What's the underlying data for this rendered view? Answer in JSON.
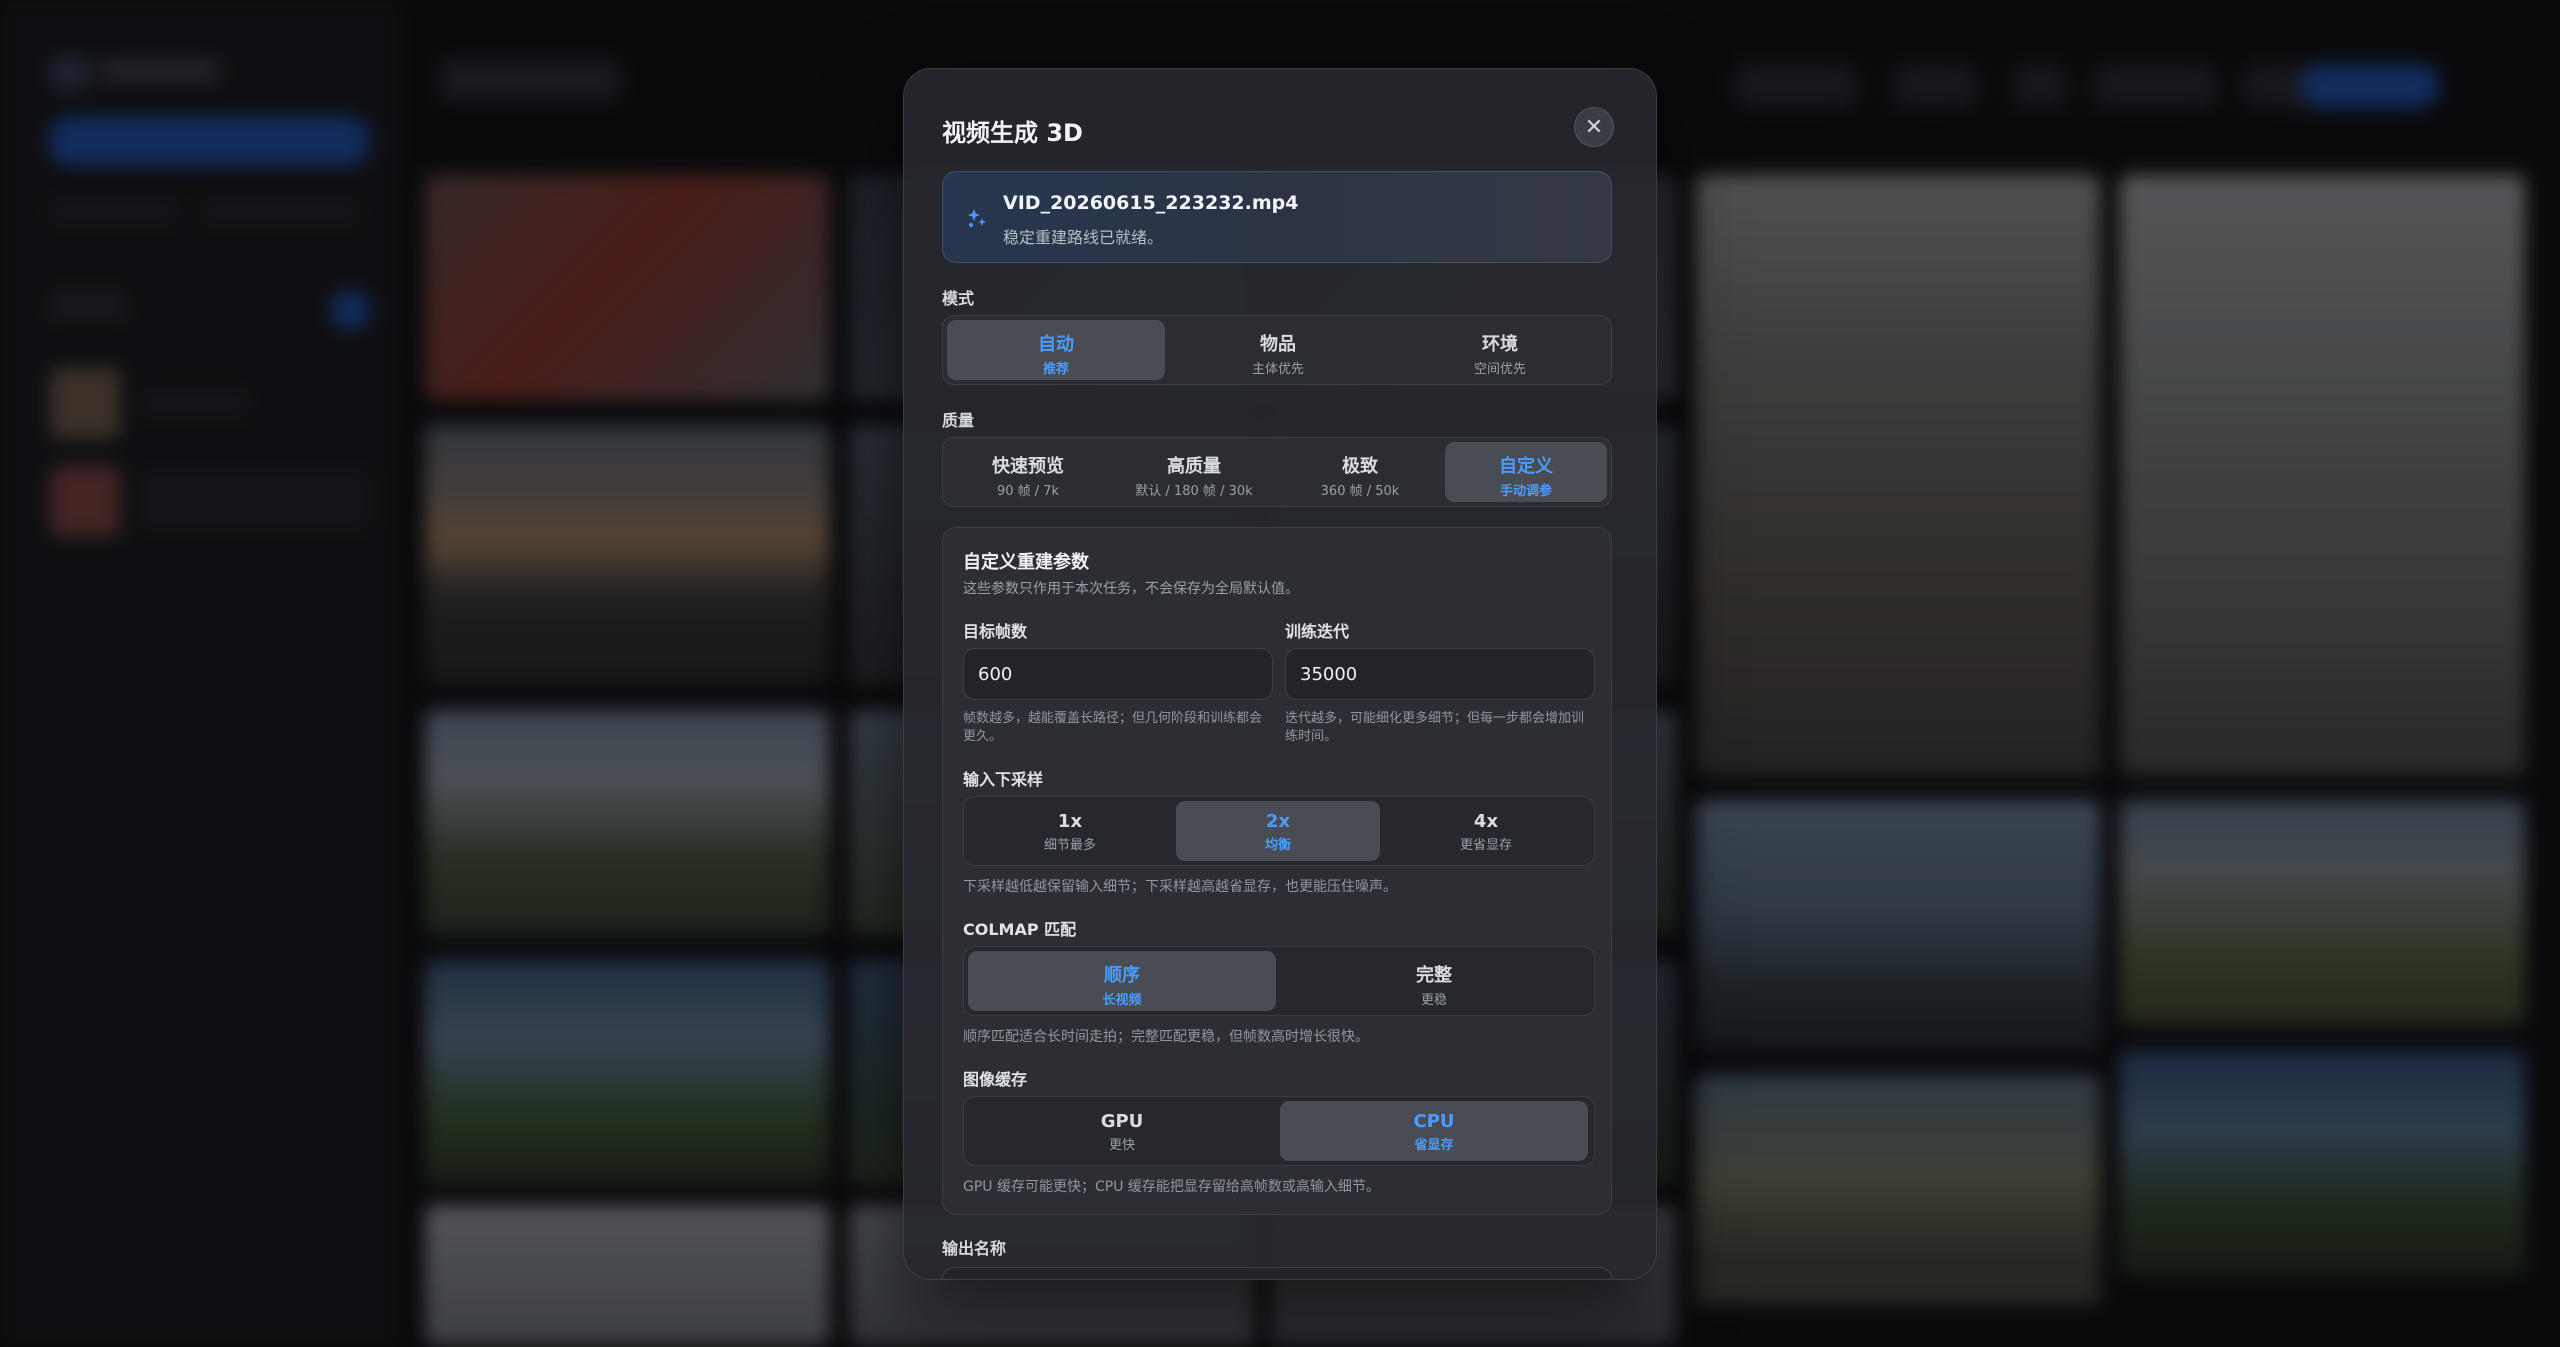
{
  "dialog": {
    "title": "视频生成 3D",
    "file_name": "VID_20260615_223232.mp4",
    "file_status": "稳定重建路线已就绪。"
  },
  "mode": {
    "label": "模式",
    "options": [
      {
        "title": "自动",
        "sub": "推荐",
        "selected": true
      },
      {
        "title": "物品",
        "sub": "主体优先",
        "selected": false
      },
      {
        "title": "环境",
        "sub": "空间优先",
        "selected": false
      }
    ]
  },
  "quality": {
    "label": "质量",
    "options": [
      {
        "title": "快速预览",
        "sub": "90 帧 / 7k",
        "selected": false
      },
      {
        "title": "高质量",
        "sub": "默认 / 180 帧 / 30k",
        "selected": false
      },
      {
        "title": "极致",
        "sub": "360 帧 / 50k",
        "selected": false
      },
      {
        "title": "自定义",
        "sub": "手动调参",
        "selected": true
      }
    ]
  },
  "custom": {
    "title": "自定义重建参数",
    "description": "这些参数只作用于本次任务，不会保存为全局默认值。",
    "target_frames": {
      "label": "目标帧数",
      "value": "600",
      "hint": "帧数越多，越能覆盖长路径；但几何阶段和训练都会更久。"
    },
    "train_iters": {
      "label": "训练迭代",
      "value": "35000",
      "hint": "迭代越多，可能细化更多细节；但每一步都会增加训练时间。"
    },
    "downsample": {
      "label": "输入下采样",
      "options": [
        {
          "title": "1x",
          "sub": "细节最多",
          "selected": false
        },
        {
          "title": "2x",
          "sub": "均衡",
          "selected": true
        },
        {
          "title": "4x",
          "sub": "更省显存",
          "selected": false
        }
      ],
      "hint": "下采样越低越保留输入细节；下采样越高越省显存，也更能压住噪声。"
    },
    "colmap": {
      "label": "COLMAP 匹配",
      "options": [
        {
          "title": "顺序",
          "sub": "长视频",
          "selected": true
        },
        {
          "title": "完整",
          "sub": "更稳",
          "selected": false
        }
      ],
      "hint": "顺序匹配适合长时间走拍；完整匹配更稳，但帧数高时增长很快。"
    },
    "image_cache": {
      "label": "图像缓存",
      "options": [
        {
          "title": "GPU",
          "sub": "更快",
          "selected": false
        },
        {
          "title": "CPU",
          "sub": "省显存",
          "selected": true
        }
      ],
      "hint": "GPU 缓存可能更快；CPU 缓存能把显存留给高帧数或高输入细节。"
    }
  },
  "output": {
    "label": "输出名称"
  },
  "colors": {
    "accent": "#4b9cff",
    "modal_bg": "#26282d",
    "selected_segment": "#494c53"
  }
}
